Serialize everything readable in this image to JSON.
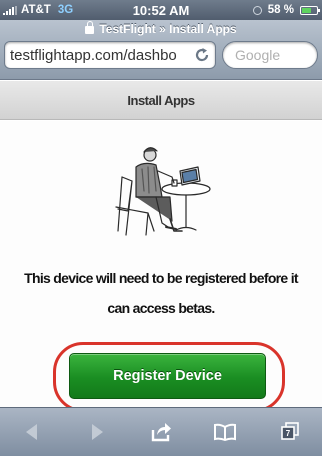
{
  "status_bar": {
    "carrier": "AT&T",
    "network": "3G",
    "time": "10:52 AM",
    "battery": "58 %"
  },
  "browser": {
    "page_title": "TestFlight » Install Apps",
    "url": "testflightapp.com/dashbo",
    "search_placeholder": "Google",
    "tab_count": "7"
  },
  "page": {
    "header": "Install Apps",
    "message": "This device will need to be registered before it can access betas.",
    "register_button": "Register Device"
  },
  "icons": {
    "illustration": "person-at-laptop-illustration",
    "back": "back-arrow-icon",
    "forward": "forward-arrow-icon",
    "share": "share-icon",
    "bookmarks": "bookmarks-icon",
    "tabs": "tabs-icon"
  },
  "colors": {
    "button": "#1a8d22",
    "highlight": "#d9342b"
  }
}
